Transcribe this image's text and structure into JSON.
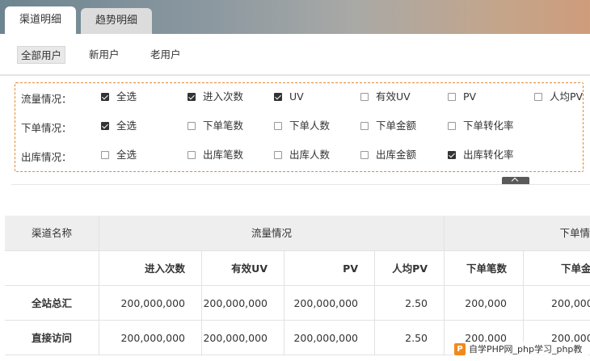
{
  "tabs": [
    {
      "label": "渠道明细",
      "active": true
    },
    {
      "label": "趋势明细",
      "active": false
    }
  ],
  "user_filter": {
    "items": [
      "全部用户",
      "新用户",
      "老用户"
    ],
    "selected": "全部用户"
  },
  "filters": [
    {
      "label": "流量情况：",
      "options": [
        {
          "text": "全选",
          "checked": true
        },
        {
          "text": "进入次数",
          "checked": true
        },
        {
          "text": "UV",
          "checked": true
        },
        {
          "text": "有效UV",
          "checked": false
        },
        {
          "text": "PV",
          "checked": false
        },
        {
          "text": "人均PV",
          "checked": false
        }
      ]
    },
    {
      "label": "下单情况：",
      "options": [
        {
          "text": "全选",
          "checked": true
        },
        {
          "text": "下单笔数",
          "checked": false
        },
        {
          "text": "下单人数",
          "checked": false
        },
        {
          "text": "下单金额",
          "checked": false
        },
        {
          "text": "下单转化率",
          "checked": false
        }
      ]
    },
    {
      "label": "出库情况：",
      "options": [
        {
          "text": "全选",
          "checked": false
        },
        {
          "text": "出库笔数",
          "checked": false
        },
        {
          "text": "出库人数",
          "checked": false
        },
        {
          "text": "出库金额",
          "checked": false
        },
        {
          "text": "出库转化率",
          "checked": true
        }
      ]
    }
  ],
  "table": {
    "group_headers": [
      "渠道名称",
      "流量情况",
      "下单情"
    ],
    "column_headers": [
      "进入次数",
      "有效UV",
      "PV",
      "人均PV",
      "下单笔数",
      "下单金"
    ],
    "rows": [
      {
        "name": "全站总汇",
        "values": [
          "200,000,000",
          "200,000,000",
          "200,000,000",
          "2.50",
          "200,000",
          "200,000"
        ]
      },
      {
        "name": "直接访问",
        "values": [
          "200,000,000",
          "200,000,000",
          "200,000,000",
          "2.50",
          "200,000",
          "200,000"
        ]
      }
    ]
  },
  "watermark": {
    "logo": "P",
    "text": "自学PHP网_php学习_php教"
  },
  "colors": {
    "dashed_border": "#e08a3a",
    "checkbox_on": "#333333"
  }
}
